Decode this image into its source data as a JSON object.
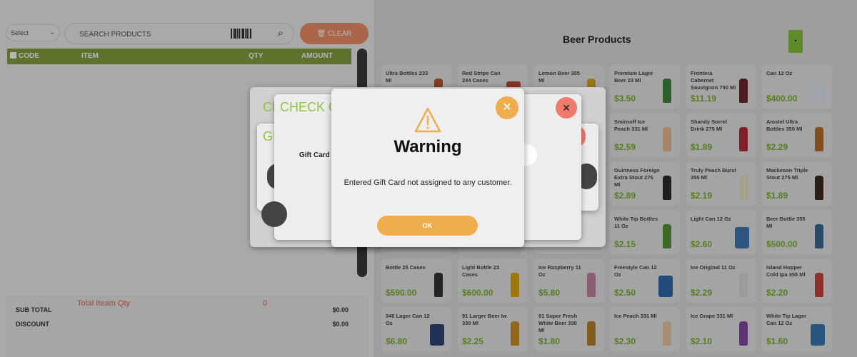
{
  "left": {
    "select": {
      "value": "Select"
    },
    "search": {
      "placeholder": "SEARCH PRODUCTS"
    },
    "clear_label": "CLEAR",
    "table_headers": {
      "code": "CODE",
      "item": "ITEM",
      "qty": "QTY",
      "amount": "AMOUNT"
    },
    "summary": {
      "subtotal_label": "SUB TOTAL",
      "subtotal_value": "$0.00",
      "discount_label": "DISCOUNT",
      "discount_value": "$0.00",
      "total_item_qty_label": "Total Iteam Qty",
      "total_item_qty_value": "0"
    }
  },
  "right": {
    "heading": "Beer Products",
    "menu_button": "•",
    "products": [
      {
        "name": "Ultra Bottles 233 Ml",
        "price": "",
        "color": "#b34a1a"
      },
      {
        "name": "Red Stripe Can 244 Cases",
        "price": "",
        "color": "#c0392b"
      },
      {
        "name": "Lemon Beer 355 Ml",
        "price": "",
        "color": "#d4a017"
      },
      {
        "name": "Premium Lager Beer 23 Ml",
        "price": "$3.50",
        "color": "#2e7d32"
      },
      {
        "name": "Frontera Cabernet Sauvignon 750 Ml",
        "price": "$11.19",
        "color": "#5d1a1a"
      },
      {
        "name": "Can 12 Oz",
        "price": "$400.00",
        "color": "#dfe6f0"
      },
      {
        "name": "",
        "price": "",
        "color": "#999"
      },
      {
        "name": "",
        "price": "",
        "color": "#999"
      },
      {
        "name": "",
        "price": "",
        "color": "#999"
      },
      {
        "name": "Smirnoff Ice Peach 331 Ml",
        "price": "$2.59",
        "color": "#e8b98a"
      },
      {
        "name": "Shandy Sorrel Drink 275 Ml",
        "price": "$1.89",
        "color": "#b2182b"
      },
      {
        "name": "Amstel Ultra Bottles 355 Ml",
        "price": "$2.29",
        "color": "#b5651d"
      },
      {
        "name": "",
        "price": "",
        "color": "#999"
      },
      {
        "name": "",
        "price": "",
        "color": "#999"
      },
      {
        "name": "",
        "price": "",
        "color": "#999"
      },
      {
        "name": "Guinness Foreign Extra Stout 275 Ml",
        "price": "$2.89",
        "color": "#1a1a1a"
      },
      {
        "name": "Truly Peach Burst 355 Ml",
        "price": "$2.19",
        "color": "#e9e0c0"
      },
      {
        "name": "Mackeson Triple Stout 275 Ml",
        "price": "$1.89",
        "color": "#2b1a0f"
      },
      {
        "name": "",
        "price": "",
        "color": "#999"
      },
      {
        "name": "",
        "price": "",
        "color": "#999"
      },
      {
        "name": "",
        "price": "",
        "color": "#999"
      },
      {
        "name": "White Tip Bottles 11 Oz",
        "price": "$2.15",
        "color": "#4a8c2a"
      },
      {
        "name": "Light Can 12 Oz",
        "price": "$2.60",
        "color": "#2f6fb0"
      },
      {
        "name": "Beer Bottle 355 Ml",
        "price": "$500.00",
        "color": "#2a5d8a"
      },
      {
        "name": "Bottle 25 Cases",
        "price": "$590.00",
        "color": "#222"
      },
      {
        "name": "Light Bottle 23 Cases",
        "price": "$600.00",
        "color": "#d9a400"
      },
      {
        "name": "Ice Raspberry 11 Oz",
        "price": "$5.80",
        "color": "#c27ba0"
      },
      {
        "name": "Freestyle Can 12 Oz",
        "price": "$2.50",
        "color": "#1f5fa8"
      },
      {
        "name": "Ice Original 11 Oz",
        "price": "$2.29",
        "color": "#d8d8d8"
      },
      {
        "name": "Island Hopper Cold Ipa 355 Ml",
        "price": "$2.20",
        "color": "#c0392b"
      },
      {
        "name": "346 Lager Can 12 Oz",
        "price": "$6.80",
        "color": "#1e3a6e"
      },
      {
        "name": "91 Larger Beer Iw 330 Ml",
        "price": "$2.25",
        "color": "#c98a1a"
      },
      {
        "name": "91 Super Fresh White Beer 330 Ml",
        "price": "$1.80",
        "color": "#b37a1a"
      },
      {
        "name": "Ice Peach 331 Ml",
        "price": "$2.30",
        "color": "#e8c4a0"
      },
      {
        "name": "Ice Grape 331 Ml",
        "price": "$2.10",
        "color": "#7d3c98"
      },
      {
        "name": "White Tip Lager Can 12 Oz",
        "price": "$1.60",
        "color": "#2a6fb0"
      }
    ]
  },
  "dialogs": {
    "check_title": "CHECK G",
    "check_title_back": "CH",
    "gift_title": "GI",
    "gift_card_label": "Gift Card",
    "warning": {
      "title": "Warning",
      "message": "Entered Gift Card not assigned to any customer.",
      "ok_label": "OK",
      "close_symbol": "✕"
    },
    "close_symbol": "✕"
  }
}
